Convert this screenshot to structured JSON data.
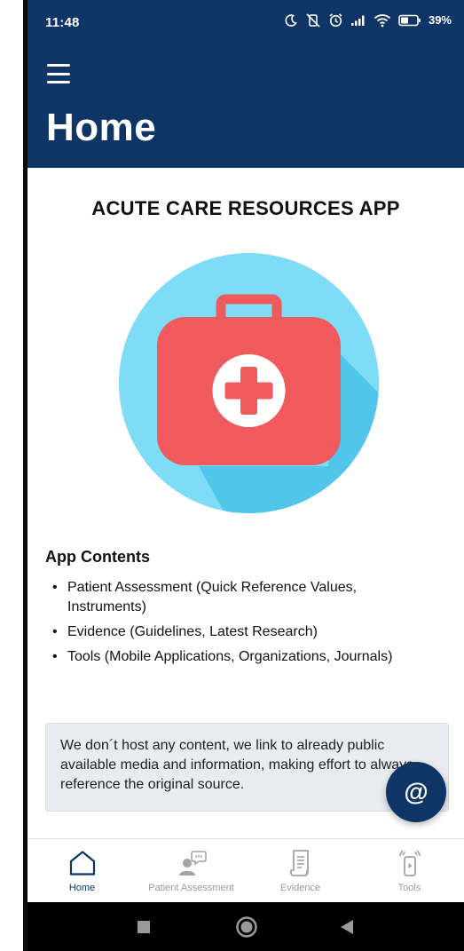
{
  "status_bar": {
    "time": "11:48",
    "battery_percent": "39%",
    "icons": [
      "moon-icon",
      "muted-vibrate-icon",
      "alarm-icon",
      "signal-icon",
      "wifi-icon",
      "battery-icon"
    ]
  },
  "header": {
    "menu_icon": "hamburger-icon",
    "title": "Home",
    "background_color": "#0f3566"
  },
  "main": {
    "app_title": "ACUTE CARE RESOURCES APP",
    "hero_icon": "first-aid-kit-icon",
    "contents_heading": "App Contents",
    "contents_items": [
      "Patient Assessment (Quick Reference Values, Instruments)",
      "Evidence (Guidelines, Latest Research)",
      "Tools (Mobile Applications, Organizations, Journals)"
    ],
    "notice_text": "We don´t host any content, we link to already public available media and information, making effort to always reference the original source."
  },
  "fab": {
    "label": "@",
    "icon": "at-sign-icon"
  },
  "tab_bar": {
    "tabs": [
      {
        "label": "Home",
        "icon": "home-icon",
        "active": true
      },
      {
        "label": "Patient Assessment",
        "icon": "person-speech-icon",
        "active": false
      },
      {
        "label": "Evidence",
        "icon": "document-icon",
        "active": false
      },
      {
        "label": "Tools",
        "icon": "phone-signal-icon",
        "active": false
      }
    ]
  },
  "system_nav": {
    "buttons": [
      "recents-button",
      "home-button",
      "back-button"
    ]
  },
  "colors": {
    "primary": "#0f3566",
    "hero_circle": "#7fdcf6",
    "kit_red": "#f05a5c",
    "tab_inactive": "#9a9a9a"
  }
}
